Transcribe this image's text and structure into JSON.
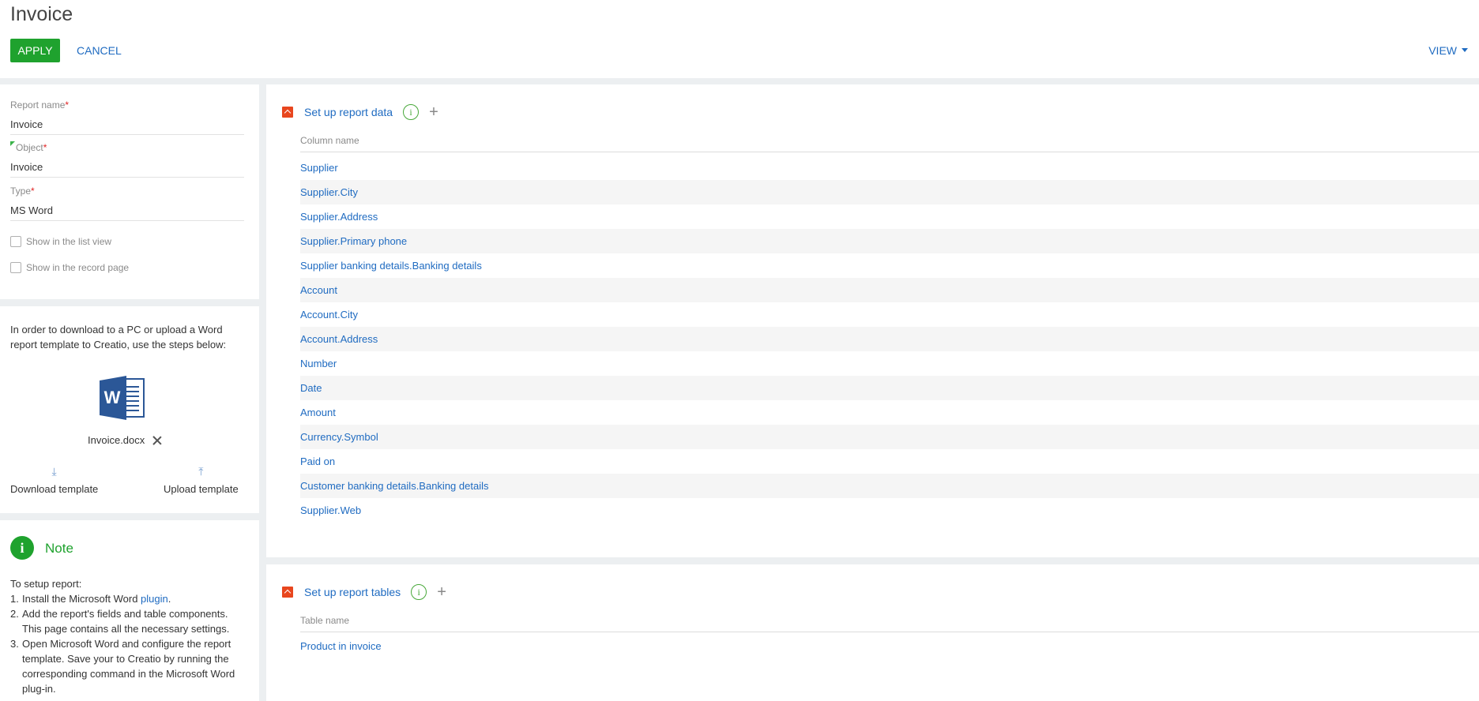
{
  "header": {
    "title": "Invoice",
    "apply_label": "APPLY",
    "cancel_label": "CANCEL",
    "view_label": "VIEW"
  },
  "form": {
    "report_name": {
      "label": "Report name",
      "required_mark": "*",
      "value": "Invoice"
    },
    "object": {
      "label": "Object",
      "required_mark": "*",
      "value": "Invoice"
    },
    "type": {
      "label": "Type",
      "required_mark": "*",
      "value": "MS Word"
    },
    "show_in_list_view": {
      "label": "Show in the list view",
      "checked": false
    },
    "show_in_record_page": {
      "label": "Show in the record page",
      "checked": false
    }
  },
  "template": {
    "info_text": "In order to download to a PC or upload a Word report template to Creatio, use the steps below:",
    "icon": "ms-word-icon",
    "file_name": "Invoice.docx",
    "download_label": "Download template",
    "upload_label": "Upload template"
  },
  "note": {
    "title": "Note",
    "intro": "To setup report:",
    "steps": [
      {
        "num": "1.",
        "text": "Install the Microsoft Word ",
        "link": "plugin",
        "tail": "."
      },
      {
        "num": "2.",
        "text": "Add the report's fields and table components. This page contains all the necessary settings."
      },
      {
        "num": "3.",
        "text": "Open Microsoft Word and configure the report template. Save your to Creatio by running the corresponding command in the Microsoft Word plug-in."
      }
    ]
  },
  "report_data": {
    "title": "Set up report data",
    "column_header": "Column name",
    "columns": [
      "Supplier",
      "Supplier.City",
      "Supplier.Address",
      "Supplier.Primary phone",
      "Supplier banking details.Banking details",
      "Account",
      "Account.City",
      "Account.Address",
      "Number",
      "Date",
      "Amount",
      "Currency.Symbol",
      "Paid on",
      "Customer banking details.Banking details",
      "Supplier.Web"
    ]
  },
  "report_tables": {
    "title": "Set up report tables",
    "column_header": "Table name",
    "tables": [
      "Product in invoice"
    ]
  },
  "colors": {
    "accent_green": "#1fa22e",
    "link_blue": "#1f6bc1",
    "collapse_orange": "#e8461e"
  }
}
